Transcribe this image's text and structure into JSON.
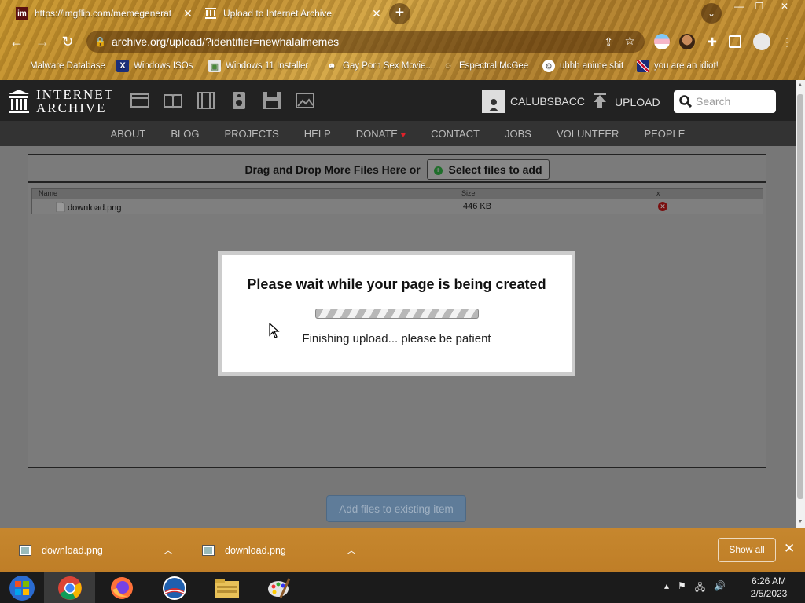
{
  "browser": {
    "tabs": [
      {
        "title": "https://imgflip.com/memegenerat",
        "favicon": "imgflip-icon"
      },
      {
        "title": "Upload to Internet Archive",
        "favicon": "archive-icon"
      }
    ],
    "address": "archive.org/upload/?identifier=newhalalmemes",
    "bookmarks": [
      "Malware Database",
      "Windows ISOs",
      "Windows 11 Installer",
      "Gay Porn Sex Movie...",
      "Espectral McGee",
      "uhhh anime shit",
      "you are an idiot!"
    ]
  },
  "ia": {
    "logo_line1": "INTERNET",
    "logo_line2": "ARCHIVE",
    "username": "CALUBSBACC",
    "upload_label": "UPLOAD",
    "search_placeholder": "Search",
    "nav": [
      "ABOUT",
      "BLOG",
      "PROJECTS",
      "HELP",
      "DONATE",
      "CONTACT",
      "JOBS",
      "VOLUNTEER",
      "PEOPLE"
    ],
    "donate_heart": "♥"
  },
  "upload": {
    "drop_text": "Drag and Drop More Files Here or",
    "select_button": "Select files to add",
    "columns": {
      "name": "Name",
      "size": "Size",
      "delete": "x"
    },
    "files": [
      {
        "name": "download.png",
        "size": "446 KB"
      }
    ],
    "add_button": "Add files to existing item"
  },
  "modal": {
    "heading": "Please wait while your page is being created",
    "status": "Finishing upload... please be patient"
  },
  "downloads": {
    "items": [
      "download.png",
      "download.png"
    ],
    "show_all": "Show all"
  },
  "taskbar": {
    "time": "6:26 AM",
    "date": "2/5/2023"
  }
}
